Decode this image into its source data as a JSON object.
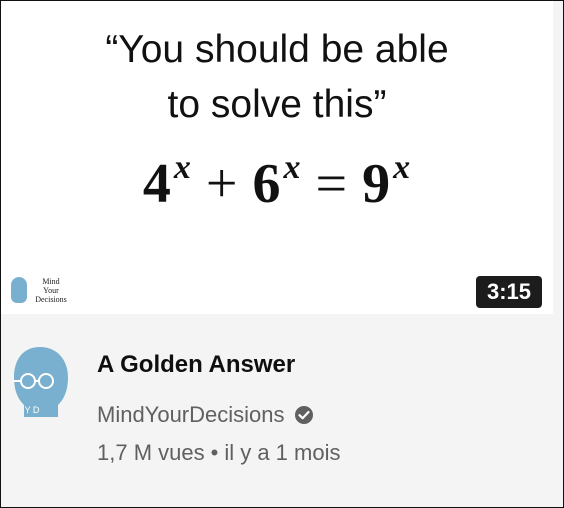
{
  "thumbnail": {
    "quote_line1": "“You should be able",
    "quote_line2": "to solve this”",
    "equation": {
      "term1_base": "4",
      "term1_exp": "x",
      "plus": "+",
      "term2_base": "6",
      "term2_exp": "x",
      "equals": "=",
      "term3_base": "9",
      "term3_exp": "x"
    },
    "logo_text": [
      "Mind",
      "Your",
      "Decisions"
    ],
    "duration": "3:15"
  },
  "video": {
    "title": "A Golden Answer",
    "channel": "MindYourDecisions",
    "views": "1,7 M vues",
    "separator": "•",
    "age": "il y a 1 mois",
    "avatar_letters": "Y D"
  },
  "colors": {
    "avatar_blue": "#7ab0cf",
    "verified_gray": "#606060",
    "badge_bg": "#1c1c1c"
  },
  "icons": {
    "verified": "verified-check-icon",
    "avatar": "channel-avatar-icon"
  }
}
